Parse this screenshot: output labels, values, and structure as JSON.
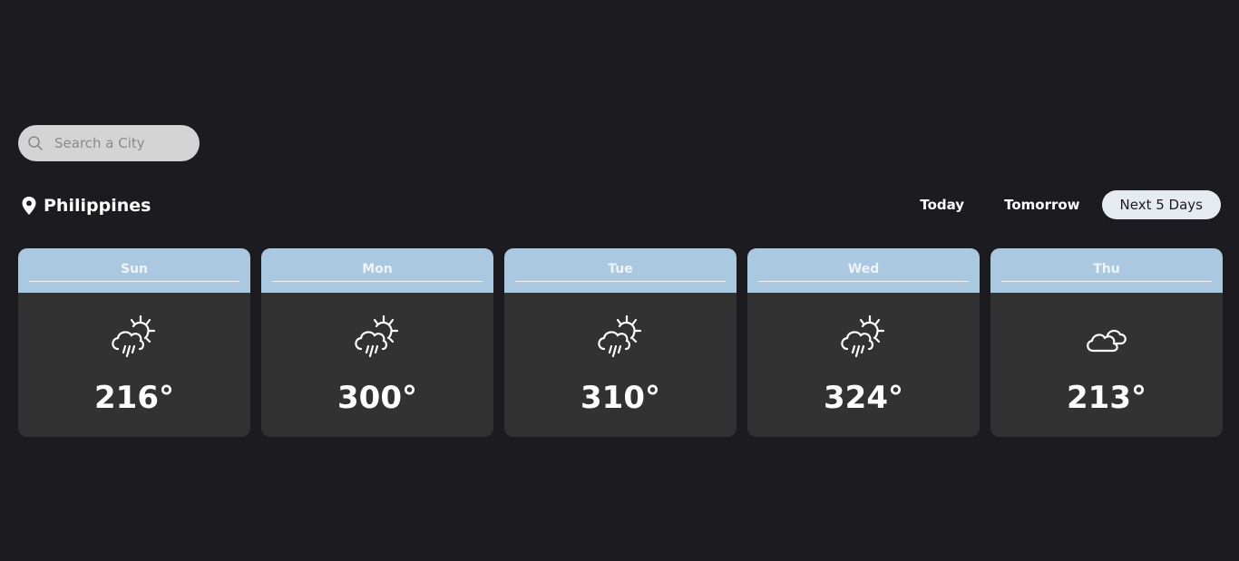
{
  "search": {
    "placeholder": "Search a City",
    "value": ""
  },
  "location": {
    "name": "Philippines"
  },
  "tabs": [
    {
      "label": "Today",
      "active": false
    },
    {
      "label": "Tomorrow",
      "active": false
    },
    {
      "label": "Next 5 Days",
      "active": true
    }
  ],
  "forecast": [
    {
      "day": "Sun",
      "temp": "216°",
      "icon": "rain-sun-icon"
    },
    {
      "day": "Mon",
      "temp": "300°",
      "icon": "rain-sun-icon"
    },
    {
      "day": "Tue",
      "temp": "310°",
      "icon": "rain-sun-icon"
    },
    {
      "day": "Wed",
      "temp": "324°",
      "icon": "rain-sun-icon"
    },
    {
      "day": "Thu",
      "temp": "213°",
      "icon": "cloudy-icon"
    }
  ],
  "colors": {
    "background": "#1c1b20",
    "card_header": "#aac8e0",
    "card_body": "#323232",
    "active_tab": "#e6ebf1",
    "search_bg": "#d4d4d4"
  }
}
